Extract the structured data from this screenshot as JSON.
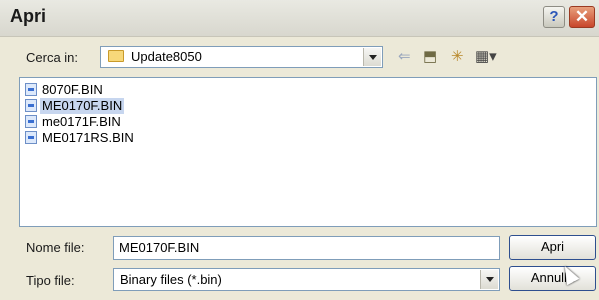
{
  "window": {
    "title": "Apri",
    "help_label": "?",
    "close_label": "✕"
  },
  "look_in": {
    "label": "Cerca in:",
    "value": "Update8050"
  },
  "toolbar": {
    "back_glyph": "⇐",
    "up_glyph": "⬒",
    "new_folder_glyph": "✳",
    "view_glyph": "▦▾"
  },
  "files": [
    {
      "name": "8070F.BIN",
      "selected": false
    },
    {
      "name": "ME0170F.BIN",
      "selected": true
    },
    {
      "name": "me0171F.BIN",
      "selected": false
    },
    {
      "name": "ME0171RS.BIN",
      "selected": false
    }
  ],
  "filename": {
    "label": "Nome file:",
    "value": "ME0170F.BIN"
  },
  "filetype": {
    "label": "Tipo file:",
    "value": "Binary files (*.bin)"
  },
  "buttons": {
    "open": "Apri",
    "cancel": "Annulla"
  }
}
